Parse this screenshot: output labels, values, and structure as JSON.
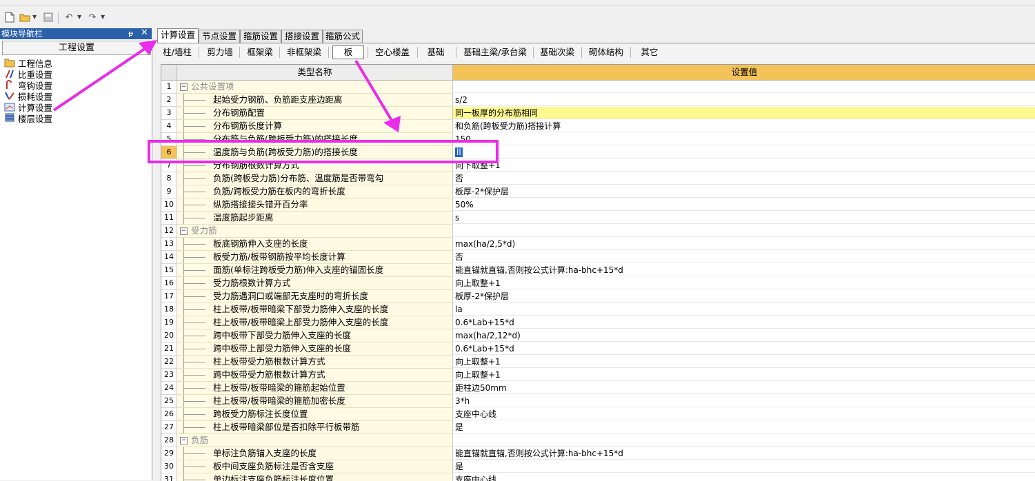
{
  "toolbar": {
    "icons": [
      "new-file-icon",
      "open-folder-icon",
      "save-icon",
      "undo-icon",
      "redo-icon"
    ]
  },
  "nav": {
    "title": "模块导航栏",
    "pin_glyph": "ᵽ",
    "close_glyph": "✕",
    "header": "工程设置",
    "items": [
      {
        "label": "工程信息",
        "icon": "project-info-icon"
      },
      {
        "label": "比重设置",
        "icon": "density-settings-icon"
      },
      {
        "label": "弯钩设置",
        "icon": "hook-settings-icon"
      },
      {
        "label": "损耗设置",
        "icon": "loss-settings-icon"
      },
      {
        "label": "计算设置",
        "icon": "calc-settings-icon"
      },
      {
        "label": "楼层设置",
        "icon": "floor-settings-icon"
      }
    ]
  },
  "tabs": [
    {
      "label": "计算设置",
      "active": true
    },
    {
      "label": "节点设置",
      "active": false
    },
    {
      "label": "箍筋设置",
      "active": false
    },
    {
      "label": "搭接设置",
      "active": false
    },
    {
      "label": "箍筋公式",
      "active": false
    }
  ],
  "subtabs": [
    {
      "label": "柱/墙柱"
    },
    {
      "label": "剪力墙"
    },
    {
      "label": "框架梁"
    },
    {
      "label": "非框架梁"
    },
    {
      "label": "板",
      "active": true
    },
    {
      "label": "空心楼盖"
    },
    {
      "label": "基础"
    },
    {
      "label": "基础主梁/承台梁"
    },
    {
      "label": "基础次梁"
    },
    {
      "label": "砌体结构"
    },
    {
      "label": "其它"
    }
  ],
  "grid": {
    "headers": {
      "name": "类型名称",
      "value": "设置值"
    },
    "rows": [
      {
        "num": "1",
        "group": true,
        "name": "公共设置项",
        "value": ""
      },
      {
        "num": "2",
        "name": "起始受力钢筋、负筋距支座边距离",
        "value": "s/2"
      },
      {
        "num": "3",
        "name": "分布钢筋配置",
        "value": "同一板厚的分布筋相同",
        "highlight": true
      },
      {
        "num": "4",
        "name": "分布钢筋长度计算",
        "value": "和负筋(跨板受力筋)搭接计算"
      },
      {
        "num": "5",
        "name": "分布筋与负筋(跨板受力筋)的搭接长度",
        "value": "150"
      },
      {
        "num": "6",
        "name": "温度筋与负筋(跨板受力筋)的搭接长度",
        "value": "ll",
        "selected": true
      },
      {
        "num": "7",
        "name": "分布钢筋根数计算方式",
        "value": "向下取整+1"
      },
      {
        "num": "8",
        "name": "负筋(跨板受力筋)分布筋、温度筋是否带弯勾",
        "value": "否"
      },
      {
        "num": "9",
        "name": "负筋/跨板受力筋在板内的弯折长度",
        "value": "板厚-2*保护层"
      },
      {
        "num": "10",
        "name": "纵筋搭接接头错开百分率",
        "value": "50%"
      },
      {
        "num": "11",
        "name": "温度筋起步距离",
        "value": "s"
      },
      {
        "num": "12",
        "group": true,
        "name": "受力筋",
        "value": ""
      },
      {
        "num": "13",
        "name": "板底钢筋伸入支座的长度",
        "value": "max(ha/2,5*d)"
      },
      {
        "num": "14",
        "name": "板受力筋/板带钢筋按平均长度计算",
        "value": "否"
      },
      {
        "num": "15",
        "name": "面筋(单标注跨板受力筋)伸入支座的锚固长度",
        "value": "能直锚就直锚,否则按公式计算:ha-bhc+15*d"
      },
      {
        "num": "16",
        "name": "受力筋根数计算方式",
        "value": "向上取整+1"
      },
      {
        "num": "17",
        "name": "受力筋遇洞口或端部无支座时的弯折长度",
        "value": "板厚-2*保护层"
      },
      {
        "num": "18",
        "name": "柱上板带/板带暗梁下部受力筋伸入支座的长度",
        "value": "la"
      },
      {
        "num": "19",
        "name": "柱上板带/板带暗梁上部受力筋伸入支座的长度",
        "value": "0.6*Lab+15*d"
      },
      {
        "num": "20",
        "name": "跨中板带下部受力筋伸入支座的长度",
        "value": "max(ha/2,12*d)"
      },
      {
        "num": "21",
        "name": "跨中板带上部受力筋伸入支座的长度",
        "value": "0.6*Lab+15*d"
      },
      {
        "num": "22",
        "name": "柱上板带受力筋根数计算方式",
        "value": "向上取整+1"
      },
      {
        "num": "23",
        "name": "跨中板带受力筋根数计算方式",
        "value": "向上取整+1"
      },
      {
        "num": "24",
        "name": "柱上板带/板带暗梁的箍筋起始位置",
        "value": "距柱边50mm"
      },
      {
        "num": "25",
        "name": "柱上板带/板带暗梁的箍筋加密长度",
        "value": "3*h"
      },
      {
        "num": "26",
        "name": "跨板受力筋标注长度位置",
        "value": "支座中心线"
      },
      {
        "num": "27",
        "name": "柱上板带暗梁部位是否扣除平行板带筋",
        "value": "是"
      },
      {
        "num": "28",
        "group": true,
        "name": "负筋",
        "value": ""
      },
      {
        "num": "29",
        "name": "单标注负筋锚入支座的长度",
        "value": "能直锚就直锚,否则按公式计算:ha-bhc+15*d"
      },
      {
        "num": "30",
        "name": "板中间支座负筋标注是否含支座",
        "value": "是"
      },
      {
        "num": "31",
        "name": "单边标注支座负筋标注长度位置",
        "value": "支座中心线"
      }
    ]
  },
  "colors": {
    "accent_header": "#f3c35a",
    "highlight_row": "#fff98f",
    "annotation": "#ea2bea",
    "nav_title_bg": "#2a5faa"
  }
}
